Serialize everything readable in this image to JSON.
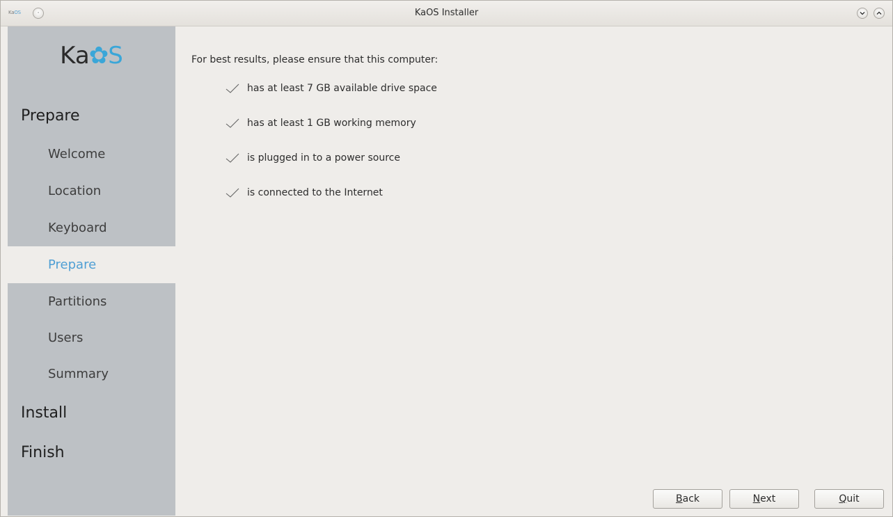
{
  "window": {
    "title": "KaOS Installer",
    "corner_logo_prefix": "Ka",
    "corner_logo_suffix": "OS"
  },
  "sidebar": {
    "logo": {
      "prefix": "Ka",
      "suffix": "S"
    },
    "sections": [
      {
        "label": "Prepare"
      },
      {
        "label": "Install"
      },
      {
        "label": "Finish"
      }
    ],
    "items": [
      {
        "label": "Welcome",
        "active": false
      },
      {
        "label": "Location",
        "active": false
      },
      {
        "label": "Keyboard",
        "active": false
      },
      {
        "label": "Prepare",
        "active": true
      },
      {
        "label": "Partitions",
        "active": false
      },
      {
        "label": "Users",
        "active": false
      },
      {
        "label": "Summary",
        "active": false
      }
    ]
  },
  "main": {
    "intro": "For best results, please ensure that this computer:",
    "requirements": [
      {
        "text": "has at least 7 GB available drive space",
        "icon": "checkmark-icon"
      },
      {
        "text": "has at least 1 GB working memory",
        "icon": "checkmark-icon"
      },
      {
        "text": "is plugged in to a power source",
        "icon": "checkmark-icon"
      },
      {
        "text": "is connected to the Internet",
        "icon": "checkmark-icon"
      }
    ]
  },
  "buttons": {
    "back": {
      "mnemonic": "B",
      "rest": "ack"
    },
    "next": {
      "mnemonic": "N",
      "rest": "ext"
    },
    "quit": {
      "mnemonic": "Q",
      "rest": "uit"
    }
  },
  "colors": {
    "accent": "#4f9fd4",
    "sidebar_bg": "#bdc1c5",
    "content_bg": "#efedea"
  }
}
